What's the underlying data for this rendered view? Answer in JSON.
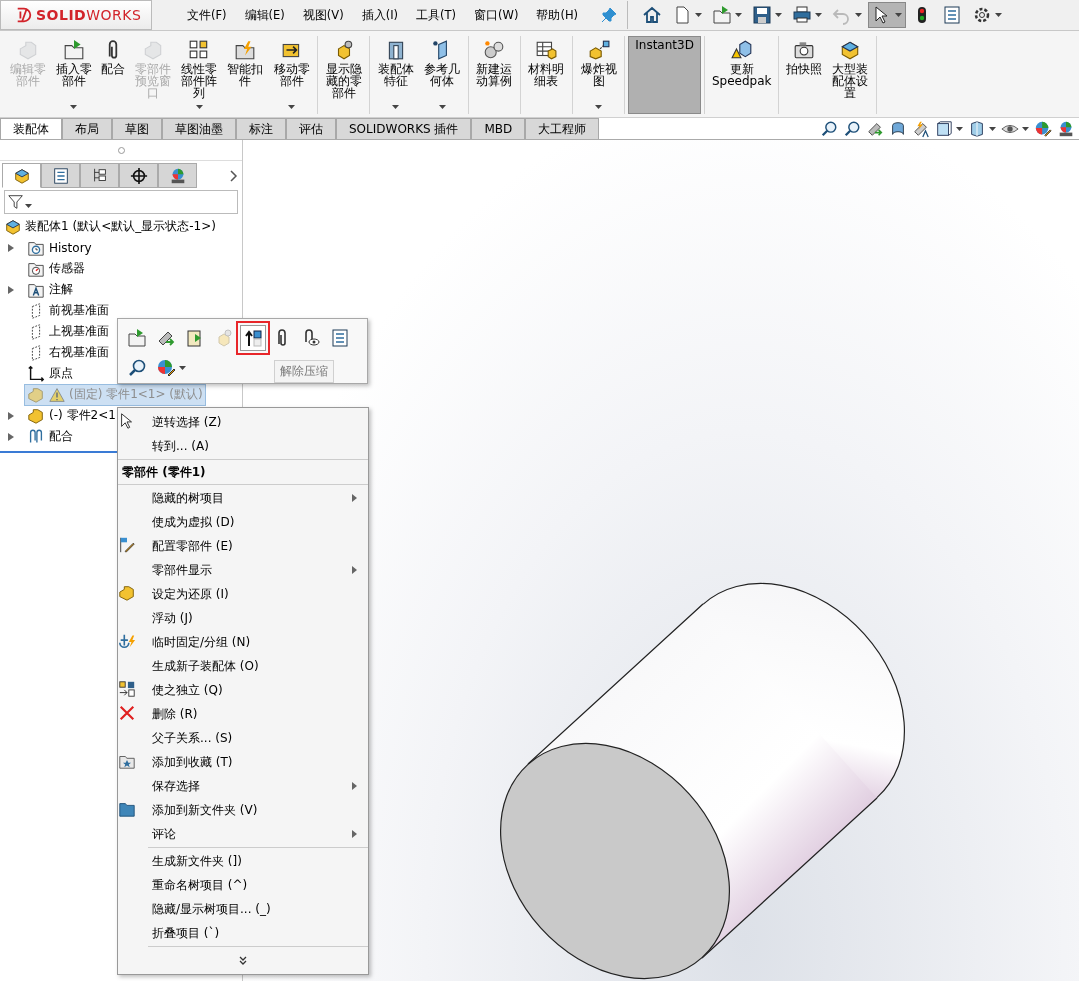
{
  "logo": {
    "text": "**SOLID**WORKS"
  },
  "menu_bar": [
    "文件(F)",
    "编辑(E)",
    "视图(V)",
    "插入(I)",
    "工具(T)",
    "窗口(W)",
    "帮助(H)"
  ],
  "quick_toolbar": [
    {
      "dropdown": false,
      "disabled": false,
      "pressed": false
    },
    {
      "dropdown": true,
      "disabled": false,
      "pressed": false
    },
    {
      "dropdown": true,
      "disabled": false,
      "pressed": false
    },
    {
      "dropdown": true,
      "disabled": false,
      "pressed": false
    },
    {
      "dropdown": true,
      "disabled": false,
      "pressed": false
    },
    {
      "dropdown": true,
      "disabled": true,
      "pressed": false
    },
    {
      "dropdown": true,
      "disabled": false,
      "pressed": true
    },
    {
      "dropdown": false,
      "disabled": false,
      "pressed": false
    },
    {
      "dropdown": false,
      "disabled": false,
      "pressed": false
    },
    {
      "dropdown": true,
      "disabled": false,
      "pressed": false
    }
  ],
  "ribbon_groups": [
    [
      {
        "label": "编辑零部件",
        "disabled": true,
        "dropdown": false,
        "on": false
      },
      {
        "label": "插入零部件",
        "disabled": false,
        "dropdown": true,
        "on": false
      },
      {
        "label": "配合",
        "disabled": false,
        "dropdown": false,
        "on": false
      },
      {
        "label": "零部件预览窗口",
        "disabled": true,
        "dropdown": false,
        "on": false
      },
      {
        "label": "线性零部件阵列",
        "disabled": false,
        "dropdown": true,
        "on": false
      },
      {
        "label": "智能扣件",
        "disabled": false,
        "dropdown": false,
        "on": false
      },
      {
        "label": "移动零部件",
        "disabled": false,
        "dropdown": true,
        "on": false
      }
    ],
    [
      {
        "label": "显示隐藏的零部件",
        "disabled": false,
        "dropdown": false,
        "on": false
      }
    ],
    [
      {
        "label": "装配体特征",
        "disabled": false,
        "dropdown": true,
        "on": false
      },
      {
        "label": "参考几何体",
        "disabled": false,
        "dropdown": true,
        "on": false
      }
    ],
    [
      {
        "label": "新建运动算例",
        "disabled": false,
        "dropdown": false,
        "on": false
      }
    ],
    [
      {
        "label": "材料明细表",
        "disabled": false,
        "dropdown": false,
        "on": false
      }
    ],
    [
      {
        "label": "爆炸视图",
        "disabled": false,
        "dropdown": true,
        "on": false
      }
    ],
    [
      {
        "label": "Instant3D",
        "disabled": false,
        "dropdown": false,
        "on": true
      }
    ],
    [
      {
        "label": "更新Speedpak",
        "disabled": false,
        "dropdown": false,
        "on": false
      }
    ],
    [
      {
        "label": "拍快照",
        "disabled": false,
        "dropdown": false,
        "on": false
      },
      {
        "label": "大型装配体设置",
        "disabled": false,
        "dropdown": false,
        "on": false
      }
    ]
  ],
  "command_tabs": [
    {
      "label": "装配体",
      "selected": true
    },
    {
      "label": "布局",
      "selected": false
    },
    {
      "label": "草图",
      "selected": false
    },
    {
      "label": "草图油墨",
      "selected": false
    },
    {
      "label": "标注",
      "selected": false
    },
    {
      "label": "评估",
      "selected": false
    },
    {
      "label": "SOLIDWORKS 插件",
      "selected": false
    },
    {
      "label": "MBD",
      "selected": false
    },
    {
      "label": "大工程师",
      "selected": false
    }
  ],
  "panel_tabs": [
    {
      "selected": true
    },
    {
      "selected": false
    },
    {
      "selected": false
    },
    {
      "selected": false
    },
    {
      "selected": false
    }
  ],
  "tree": {
    "label": "装配体1  (默认<默认_显示状态-1>)",
    "kind": "assembly",
    "children": [
      {
        "label": "History",
        "kind": "history",
        "expandable": true,
        "selected": false,
        "warning": false,
        "suppressed": false
      },
      {
        "label": "传感器",
        "kind": "sensor",
        "expandable": false,
        "selected": false,
        "warning": false,
        "suppressed": false
      },
      {
        "label": "注解",
        "kind": "annotation",
        "expandable": true,
        "selected": false,
        "warning": false,
        "suppressed": false
      },
      {
        "label": "前视基准面",
        "kind": "plane",
        "expandable": false,
        "selected": false,
        "warning": false,
        "suppressed": false
      },
      {
        "label": "上视基准面",
        "kind": "plane",
        "expandable": false,
        "selected": false,
        "warning": false,
        "suppressed": false
      },
      {
        "label": "右视基准面",
        "kind": "plane",
        "expandable": false,
        "selected": false,
        "warning": false,
        "suppressed": false
      },
      {
        "label": "原点",
        "kind": "origin",
        "expandable": false,
        "selected": false,
        "warning": false,
        "suppressed": false
      },
      {
        "label": "(固定) 零件1<1> (默认)",
        "kind": "part",
        "expandable": false,
        "selected": true,
        "warning": true,
        "suppressed": true
      },
      {
        "label": "(-) 零件2<1",
        "kind": "part",
        "expandable": true,
        "selected": false,
        "warning": false,
        "suppressed": false
      },
      {
        "label": "配合",
        "kind": "mates",
        "expandable": true,
        "selected": false,
        "warning": false,
        "suppressed": false
      }
    ]
  },
  "context_toolbar": {
    "rows": [
      [
        {
          "disabled": false,
          "highlighted": false,
          "dropdown": false
        },
        {
          "disabled": false,
          "highlighted": false,
          "dropdown": false
        },
        {
          "disabled": false,
          "highlighted": false,
          "dropdown": false
        },
        {
          "disabled": true,
          "highlighted": false,
          "dropdown": false
        },
        {
          "disabled": false,
          "highlighted": true,
          "dropdown": false
        },
        {
          "disabled": false,
          "highlighted": false,
          "dropdown": false
        },
        {
          "disabled": false,
          "highlighted": false,
          "dropdown": false
        },
        {
          "disabled": false,
          "highlighted": false,
          "dropdown": false
        }
      ],
      [
        {
          "disabled": false,
          "highlighted": false,
          "dropdown": false
        },
        {
          "disabled": false,
          "highlighted": false,
          "dropdown": true
        }
      ]
    ],
    "tooltip": "解除压缩"
  },
  "context_menu": {
    "sections": [
      {
        "items": [
          {
            "label": "逆转选择 (Z)",
            "kind": "item",
            "submenu": false
          },
          {
            "label": "转到... (A)",
            "kind": "item",
            "submenu": false
          }
        ]
      },
      {
        "items": [
          {
            "label": "零部件 (零件1)",
            "kind": "header"
          }
        ]
      },
      {
        "items": [
          {
            "label": "隐藏的树项目",
            "kind": "item",
            "submenu": true
          },
          {
            "label": "使成为虚拟 (D)",
            "kind": "item",
            "submenu": false
          },
          {
            "label": "配置零部件 (E)",
            "kind": "item",
            "submenu": false
          },
          {
            "label": "零部件显示",
            "kind": "item",
            "submenu": true
          },
          {
            "label": "设定为还原 (I)",
            "kind": "item",
            "submenu": false
          },
          {
            "label": "浮动 (J)",
            "kind": "item",
            "submenu": false
          },
          {
            "label": "临时固定/分组 (N)",
            "kind": "item",
            "submenu": false
          },
          {
            "label": "生成新子装配体 (O)",
            "kind": "item",
            "submenu": false
          },
          {
            "label": "使之独立 (Q)",
            "kind": "item",
            "submenu": false
          },
          {
            "label": "删除 (R)",
            "kind": "item",
            "submenu": false
          },
          {
            "label": "父子关系... (S)",
            "kind": "item",
            "submenu": false
          },
          {
            "label": "添加到收藏 (T)",
            "kind": "item",
            "submenu": false
          },
          {
            "label": "保存选择",
            "kind": "item",
            "submenu": true
          },
          {
            "label": "添加到新文件夹 (V)",
            "kind": "item",
            "submenu": false
          },
          {
            "label": "评论",
            "kind": "item",
            "submenu": true
          }
        ]
      },
      {
        "items": [
          {
            "label": "生成新文件夹 (])",
            "kind": "item",
            "submenu": false
          },
          {
            "label": "重命名树项目 (^)",
            "kind": "item",
            "submenu": false
          },
          {
            "label": "隐藏/显示树项目... (_)",
            "kind": "item",
            "submenu": false
          },
          {
            "label": "折叠项目 (`)",
            "kind": "item",
            "submenu": false
          }
        ]
      }
    ]
  }
}
